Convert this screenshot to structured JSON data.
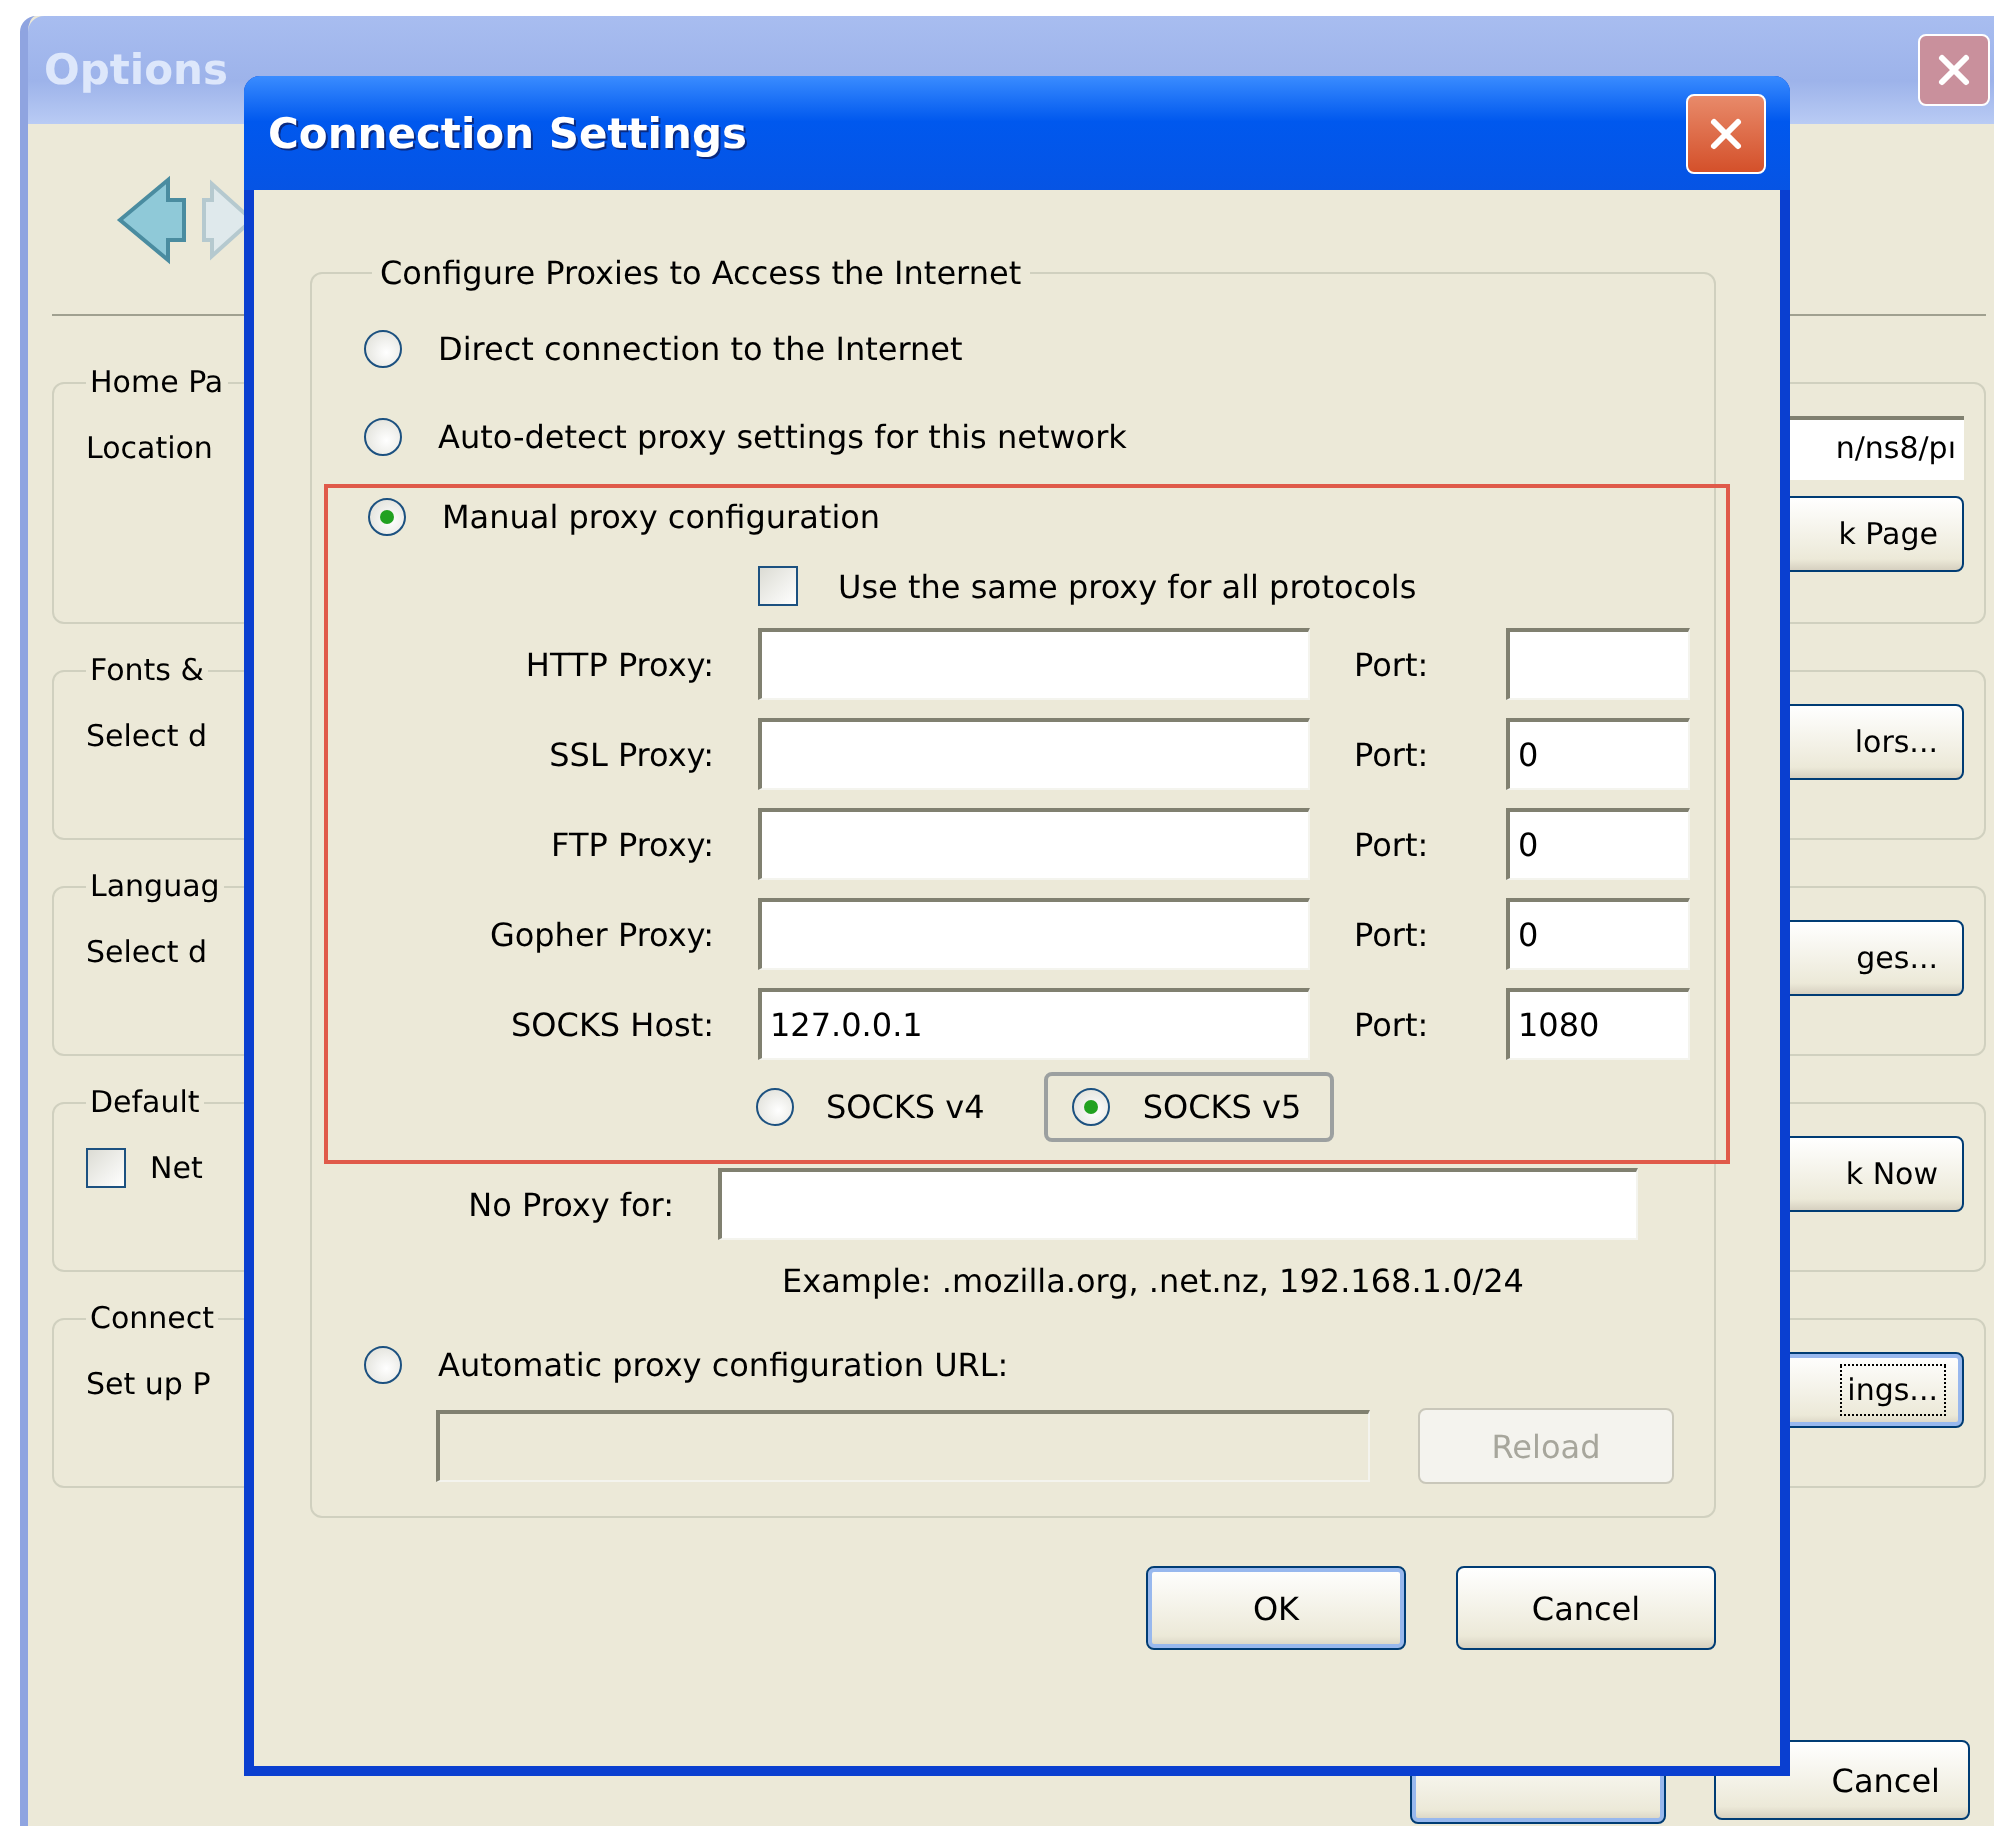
{
  "options_window": {
    "title": "Options",
    "groups": [
      {
        "title": "Home Pa",
        "label": {
          "text": "Location"
        },
        "field_value": "n/ns8/pı",
        "button": {
          "text": "k Page",
          "focused": false
        }
      },
      {
        "title": "Fonts &",
        "label": {
          "text": "Select d"
        },
        "button": {
          "text": "lors...",
          "focused": false
        }
      },
      {
        "title": "Languag",
        "label": {
          "text": "Select d"
        },
        "button": {
          "text": "ges...",
          "focused": false
        }
      },
      {
        "title": "Default",
        "checkbox": {
          "label": "Net",
          "checked": false
        },
        "button": {
          "text": "k Now",
          "focused": false
        }
      },
      {
        "title": "Connect",
        "label": {
          "text": "Set up P"
        },
        "button": {
          "text": "ings...",
          "focused": true
        }
      }
    ],
    "buttons": [
      {
        "label": "Cancel"
      }
    ]
  },
  "dialog": {
    "title": "Connection Settings",
    "group_title": "Configure Proxies to Access the Internet",
    "modes": [
      {
        "label": "Direct connection to the Internet",
        "selected": false
      },
      {
        "label": "Auto-detect proxy settings for this network",
        "selected": false
      },
      {
        "label": "Manual proxy configuration",
        "selected": true
      }
    ],
    "same_proxy": {
      "label": "Use the same proxy for all protocols",
      "checked": false
    },
    "proxies": [
      {
        "label": "HTTP Proxy:",
        "port_label": "Port:"
      },
      {
        "label": "SSL Proxy:",
        "port_label": "Port:",
        "port": "0"
      },
      {
        "label": "FTP Proxy:",
        "port_label": "Port:",
        "port": "0"
      },
      {
        "label": "Gopher Proxy:",
        "port_label": "Port:",
        "port": "0"
      },
      {
        "label": "SOCKS Host:",
        "value": "127.0.0.1",
        "port_label": "Port:",
        "port": "1080"
      }
    ],
    "socks_versions": [
      {
        "label": "SOCKS v4",
        "selected": false
      },
      {
        "label": "SOCKS v5",
        "selected": true
      }
    ],
    "no_proxy": {
      "label": "No Proxy for:"
    },
    "example": "Example: .mozilla.org, .net.nz, 192.168.1.0/24",
    "auto_config": {
      "label": "Automatic proxy configuration URL:",
      "selected": false,
      "disabled": true
    },
    "reload": {
      "label": "Reload",
      "disabled": true
    },
    "buttons": [
      {
        "label": "OK",
        "default": true
      },
      {
        "label": "Cancel",
        "default": false
      }
    ]
  }
}
